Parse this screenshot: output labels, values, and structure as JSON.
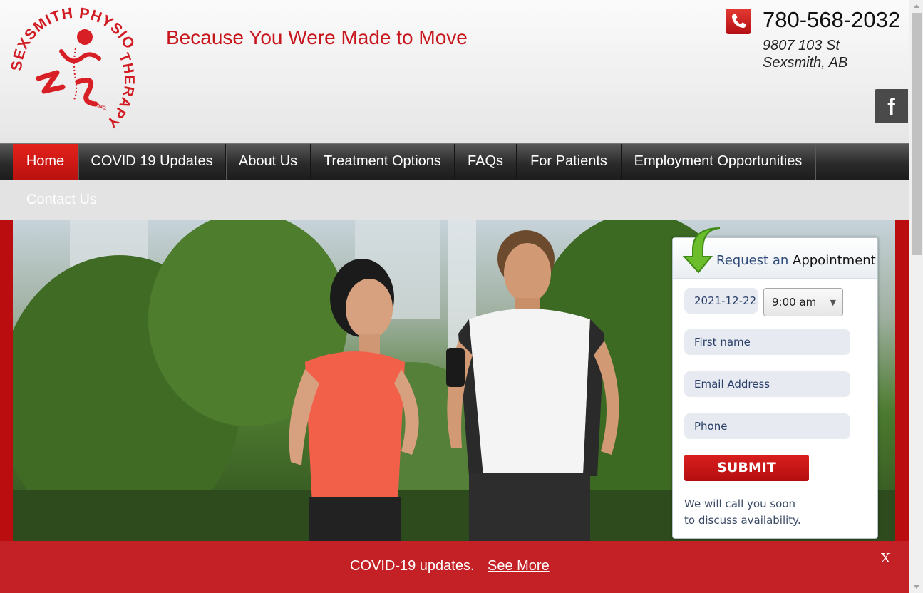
{
  "brand": {
    "name": "SEXSMITH PHYSIOTHERAPY",
    "suffix": "INC.",
    "tagline": "Because You Were Made to Move",
    "color": "#c8161d"
  },
  "contact": {
    "phone": "780-568-2032",
    "address_line1": "9807 103 St",
    "address_line2": "Sexsmith, AB"
  },
  "social": {
    "facebook_icon": "facebook-icon",
    "facebook_glyph": "f"
  },
  "nav": {
    "items": [
      {
        "label": "Home",
        "active": true
      },
      {
        "label": "COVID 19 Updates"
      },
      {
        "label": "About Us"
      },
      {
        "label": "Treatment Options"
      },
      {
        "label": "FAQs"
      },
      {
        "label": "For Patients"
      },
      {
        "label": "Employment Opportunities"
      }
    ],
    "row2": {
      "label": "Contact Us"
    }
  },
  "appointment": {
    "title_part1": "Request an",
    "title_part2": "Appointment",
    "date": "2021-12-22",
    "time": "9:00 am",
    "first_name_placeholder": "First name",
    "email_placeholder": "Email Address",
    "phone_placeholder": "Phone",
    "submit_label": "SUBMIT",
    "note_line1": "We will call you soon",
    "note_line2": "to discuss availability."
  },
  "covid_banner": {
    "text": "COVID-19 updates.",
    "link_label": "See More",
    "close_label": "X"
  }
}
